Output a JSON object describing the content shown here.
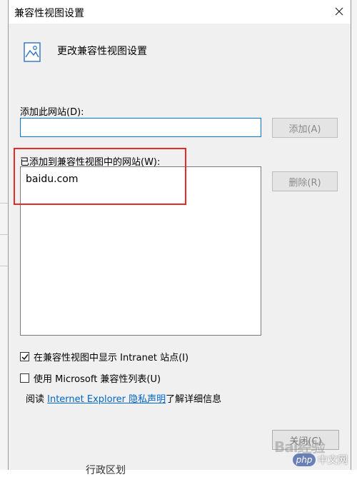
{
  "window": {
    "title": "兼容性视图设置"
  },
  "header": {
    "text": "更改兼容性视图设置"
  },
  "add_section": {
    "label": "添加此网站(D):",
    "input_value": "",
    "add_button": "添加(A)"
  },
  "list_section": {
    "label": "已添加到兼容性视图中的网站(W):",
    "items": [
      "baidu.com"
    ],
    "remove_button": "删除(R)"
  },
  "options": {
    "intranet": {
      "label": "在兼容性视图中显示 Intranet 站点(I)",
      "checked": true
    },
    "microsoft_list": {
      "label": "使用 Microsoft 兼容性列表(U)",
      "checked": false
    }
  },
  "read_more": {
    "prefix": "阅读 ",
    "link": "Internet Explorer 隐私声明",
    "suffix": "了解详细信息"
  },
  "footer": {
    "close_button": "关闭(C)"
  },
  "watermarks": {
    "baidu": "Bai经验",
    "php": "php",
    "php_site": "中文网"
  },
  "background": {
    "bottom_fragment": "行政区划"
  },
  "colors": {
    "highlight": "#e52a2a",
    "input_border": "#0078d7",
    "link": "#0066cc"
  },
  "icons": [
    "close-icon",
    "picture-settings-icon",
    "checkmark-icon"
  ]
}
